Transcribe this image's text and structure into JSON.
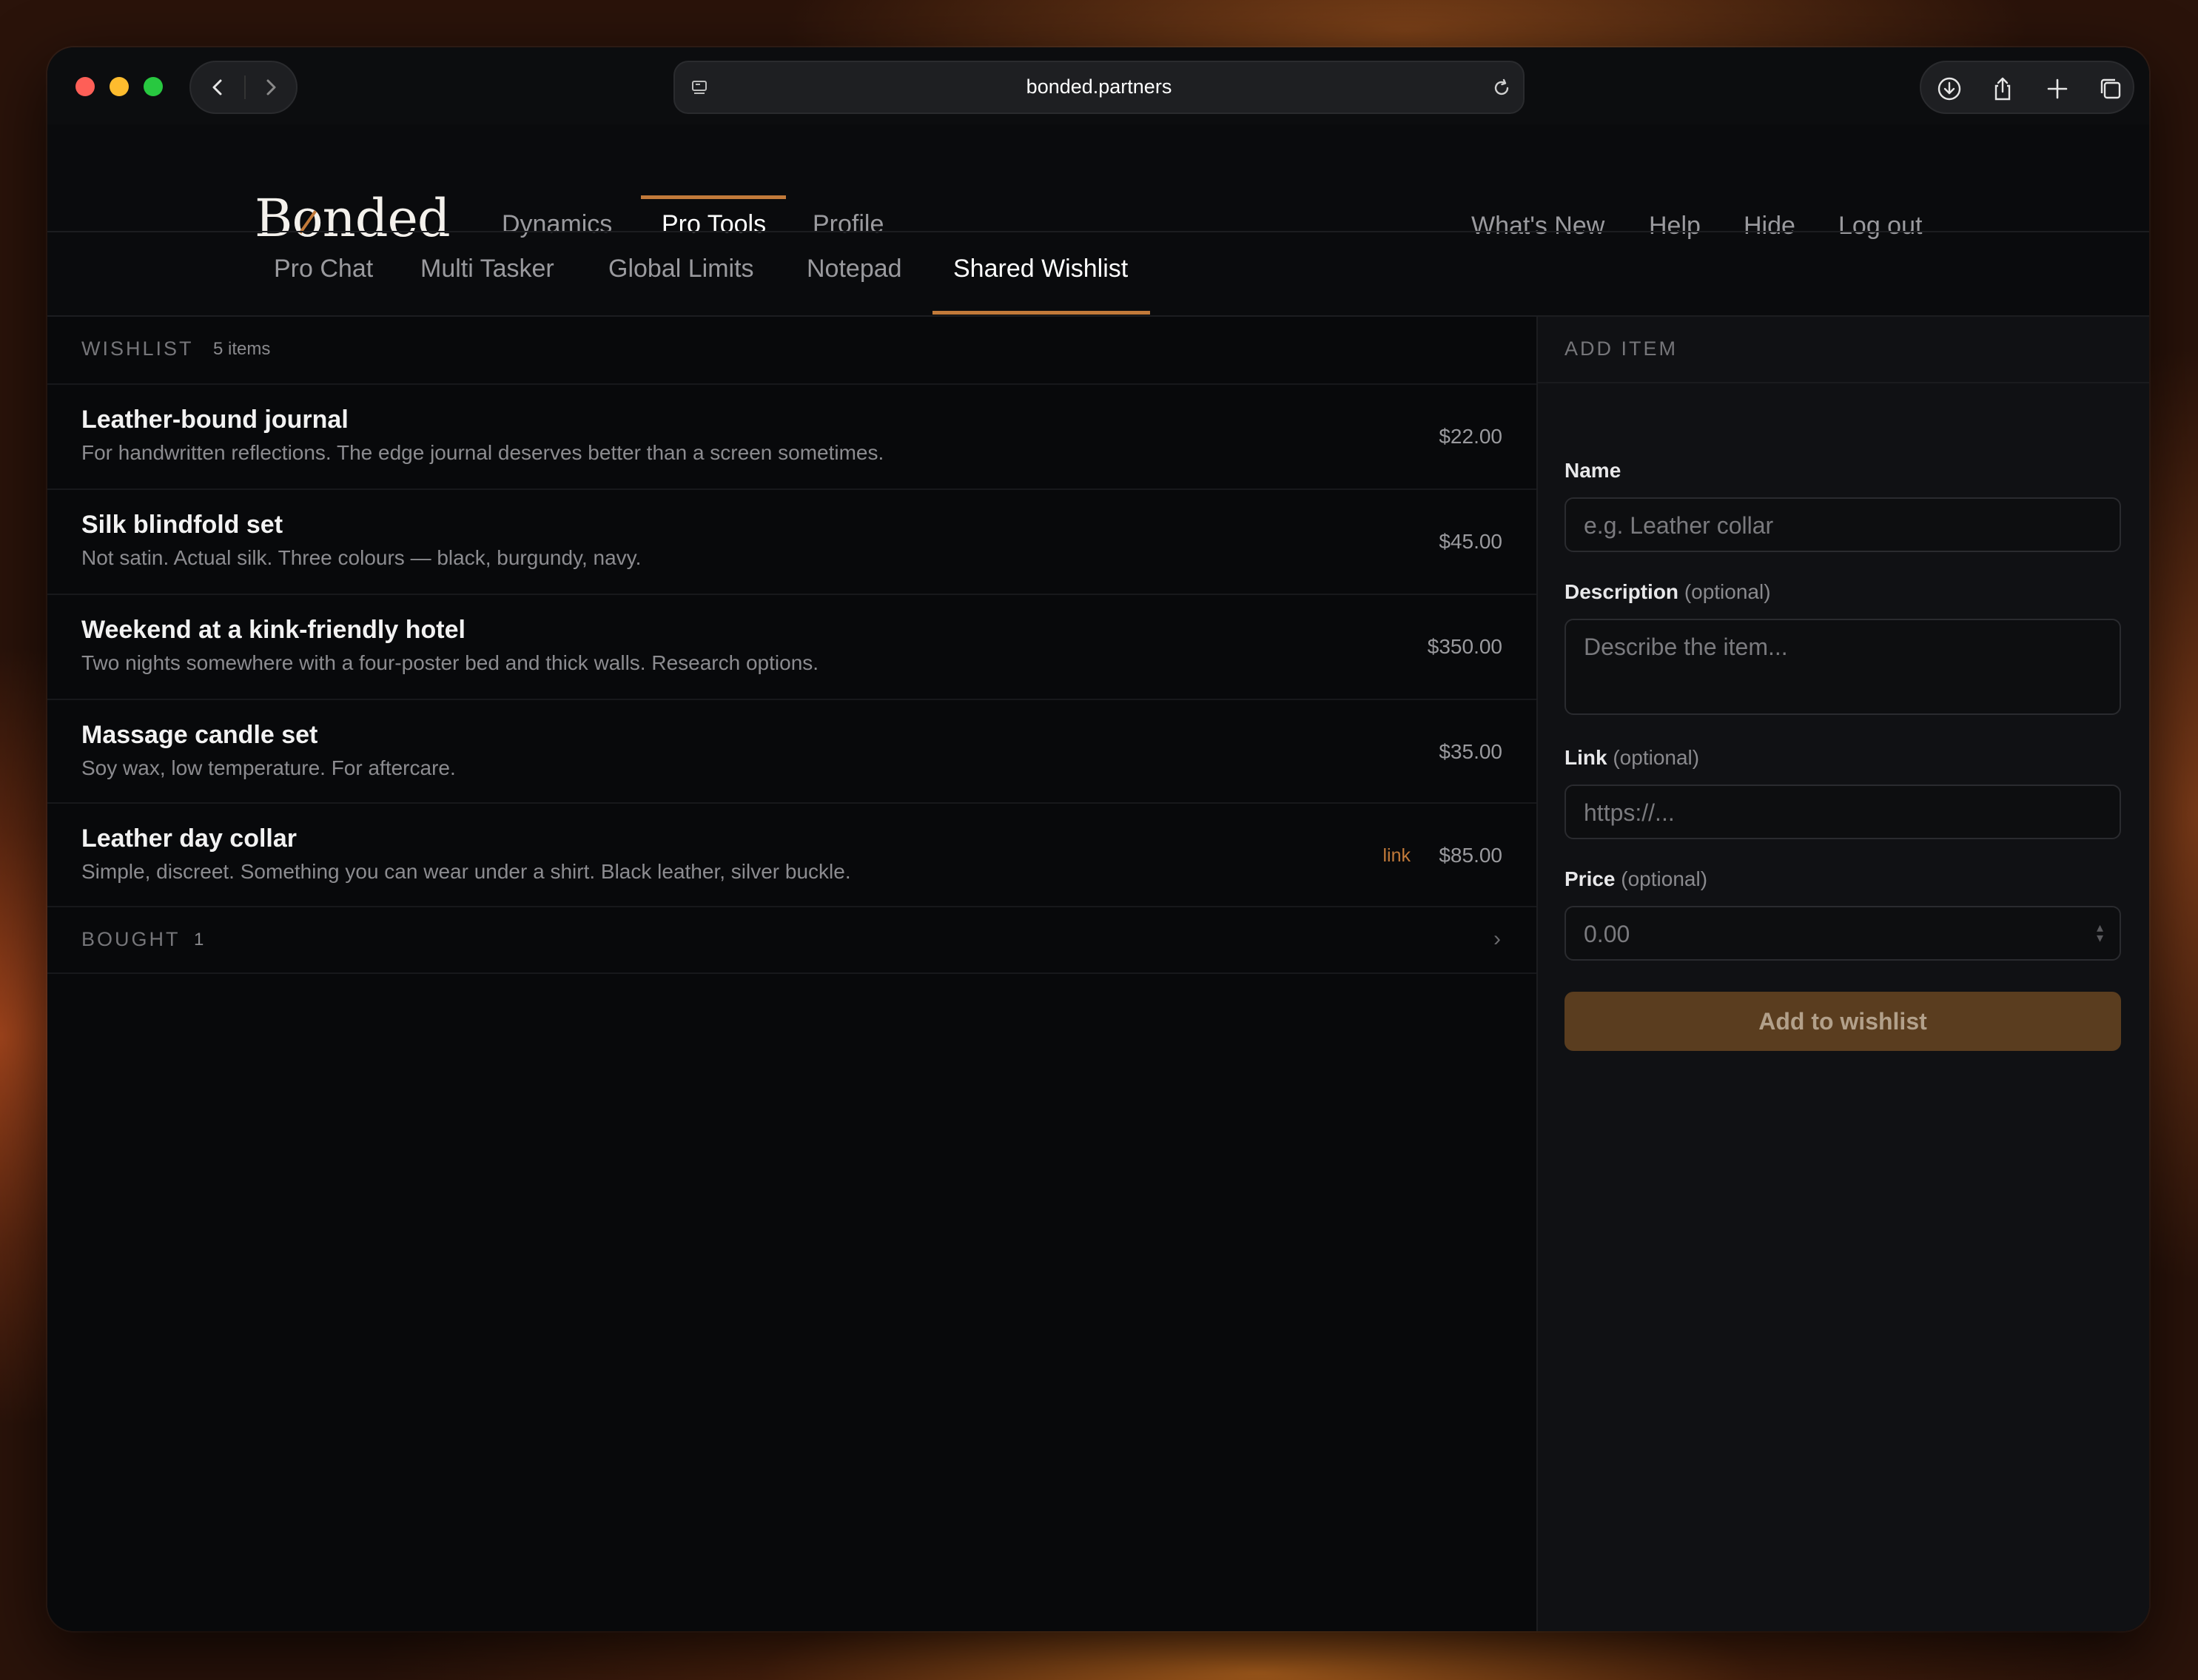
{
  "browser": {
    "url": "bonded.partners"
  },
  "app": {
    "logo": "Bonded",
    "main_nav": [
      "Dynamics",
      "Pro Tools",
      "Profile"
    ],
    "right_nav": [
      "What's New",
      "Help",
      "Hide",
      "Log out"
    ],
    "sub_nav": [
      "Pro Chat",
      "Multi Tasker",
      "Global Limits",
      "Notepad",
      "Shared Wishlist"
    ],
    "accent_color": "#c27a3a"
  },
  "wishlist": {
    "heading": "WISHLIST",
    "count": "5 items",
    "items": [
      {
        "title": "Leather-bound journal",
        "desc": "For handwritten reflections. The edge journal deserves better than a screen sometimes.",
        "price": "$22.00"
      },
      {
        "title": "Silk blindfold set",
        "desc": "Not satin. Actual silk. Three colours — black, burgundy, navy.",
        "price": "$45.00"
      },
      {
        "title": "Weekend at a kink-friendly hotel",
        "desc": "Two nights somewhere with a four-poster bed and thick walls. Research options.",
        "price": "$350.00"
      },
      {
        "title": "Massage candle set",
        "desc": "Soy wax, low temperature. For aftercare.",
        "price": "$35.00"
      },
      {
        "title": "Leather day collar",
        "desc": "Simple, discreet. Something you can wear under a shirt. Black leather, silver buckle.",
        "price": "$85.00",
        "link": "link"
      }
    ],
    "bought_heading": "BOUGHT",
    "bought_count": "1"
  },
  "add_item": {
    "heading": "ADD ITEM",
    "name_label": "Name",
    "name_placeholder": "e.g. Leather collar",
    "desc_label": "Description",
    "desc_optional": "(optional)",
    "desc_placeholder": "Describe the item...",
    "link_label": "Link",
    "link_optional": "(optional)",
    "link_placeholder": "https://...",
    "price_label": "Price",
    "price_optional": "(optional)",
    "price_placeholder": "0.00",
    "button": "Add to wishlist"
  }
}
